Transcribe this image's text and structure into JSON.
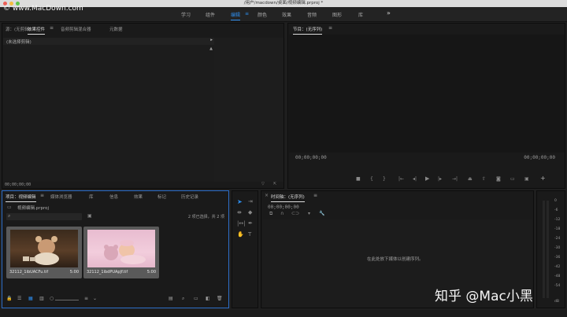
{
  "titlebar": {
    "title": "/用户/macdown/桌面/视频编辑.prproj *"
  },
  "watermark": "© www.MacDown.com",
  "workspaces": {
    "tabs": [
      {
        "label": "学习"
      },
      {
        "label": "组件"
      },
      {
        "label": "编辑"
      },
      {
        "label": "颜色"
      },
      {
        "label": "效果"
      },
      {
        "label": "音频"
      },
      {
        "label": "图形"
      },
      {
        "label": "库"
      }
    ],
    "active": "编辑",
    "more_icon": "»"
  },
  "source_panel": {
    "tabs": [
      "源：(无剪辑)",
      "效果控件",
      "音频剪辑混合器",
      "元数据"
    ],
    "active_tab": "效果控件",
    "no_clip_text": "(未选择剪辑)",
    "timecode": "00;00;00;00"
  },
  "program_panel": {
    "title": "节目：(无序列)",
    "timecode_left": "00;00;00;00",
    "timecode_right": "00;00;00;00"
  },
  "project_panel": {
    "tabs": [
      "项目：视频编辑",
      "媒体浏览器",
      "库",
      "信息",
      "效果",
      "标记",
      "历史记录"
    ],
    "active_tab": "项目：视频编辑",
    "file_name": "视频编辑.prproj",
    "search_placeholder": "",
    "selection_info": "2 项已选择，共 2 项",
    "items": [
      {
        "name": "32112_1ibUACFu.tif",
        "duration": "5:00"
      },
      {
        "name": "32112_1ibdPUApJf.tif",
        "duration": "5:00"
      }
    ]
  },
  "timeline_panel": {
    "title": "时间轴：(无序列)",
    "timecode": "00;00;00;00",
    "empty_text": "在此处放下媒体以创建序列。"
  },
  "audio_meter": {
    "scale": [
      "0",
      "-6",
      "-12",
      "-18",
      "-24",
      "-30",
      "-36",
      "-42",
      "-48",
      "-54",
      "dB"
    ]
  },
  "overlay_brand": "知乎 @Mac小黑",
  "colors": {
    "accent": "#2d8ceb",
    "panel_bg": "#1a1a1a",
    "app_bg": "#1e1e1e",
    "selection_border": "#2d6ec8"
  }
}
